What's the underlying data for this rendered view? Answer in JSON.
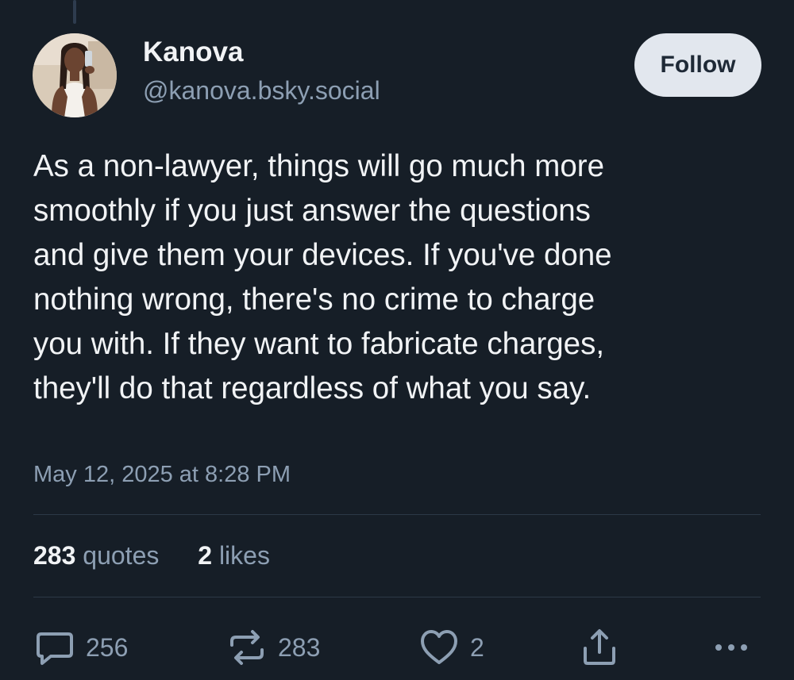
{
  "author": {
    "display_name": "Kanova",
    "handle": "@kanova.bsky.social",
    "avatar_icon": "profile-photo"
  },
  "follow_label": "Follow",
  "post": {
    "text": "As a non-lawyer, things will go much more\nsmoothly if you just answer the questions\nand give them your devices. If you've done\nnothing wrong, there's no crime to charge\nyou with. If they want to fabricate charges,\nthey'll do that regardless of what you say.",
    "timestamp": "May 12, 2025 at 8:28 PM"
  },
  "stats": {
    "quotes_count": "283",
    "quotes_label": "quotes",
    "likes_count": "2",
    "likes_label": "likes"
  },
  "actions": {
    "reply": {
      "icon": "reply-icon",
      "count": "256"
    },
    "repost": {
      "icon": "repost-icon",
      "count": "283"
    },
    "like": {
      "icon": "heart-icon",
      "count": "2"
    },
    "share": {
      "icon": "share-icon"
    },
    "more": {
      "icon": "more-icon"
    }
  },
  "colors": {
    "background": "#161e27",
    "text_primary": "#f1f3f5",
    "text_secondary": "#8d9fb3",
    "follow_button_bg": "#e2e7ee",
    "divider": "#2c3947"
  }
}
